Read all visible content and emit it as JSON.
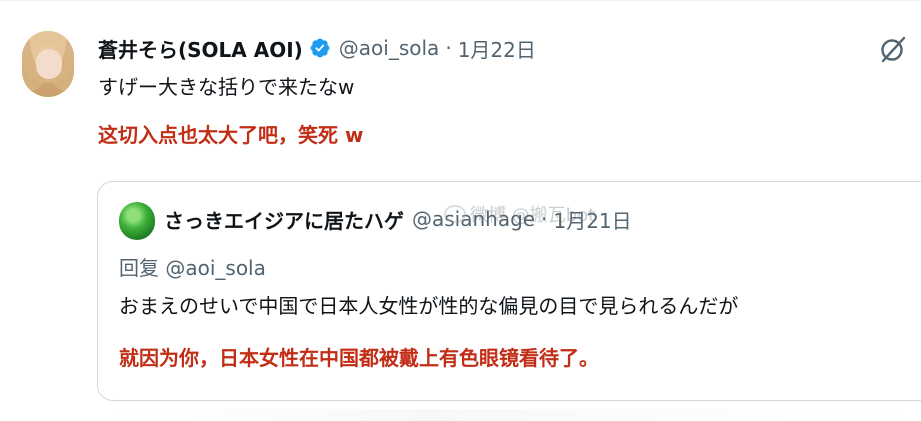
{
  "post": {
    "author": {
      "display_name": "蒼井そら(SOLA AOI)",
      "handle": "@aoi_sola",
      "verified": true,
      "avatar_icon": "user-avatar-photo"
    },
    "separator": "·",
    "date": "1月22日",
    "text": "すげー大きな括りで来たなw",
    "annotation": "这切入点也太大了吧，笑死 w",
    "grok_icon": "grok-slash-icon"
  },
  "quoted_post": {
    "author": {
      "display_name": "さっきエイジアに居たハゲ",
      "handle": "@asianhage",
      "avatar_icon": "green-blob-avatar"
    },
    "separator": "·",
    "date": "1月21日",
    "reply_to": "回复 @aoi_sola",
    "text": "おまえのせいで中国で日本人女性が性的な偏見の目で見られるんだが",
    "annotation": "就因为你，日本女性在中国都被戴上有色眼镜看待了。"
  },
  "watermark": {
    "text": "微博 @搬瓦bot"
  },
  "colors": {
    "annotation": "#c22d16",
    "secondary_text": "#536471",
    "verified_badge": "#1d9bf0",
    "border": "#cfd9de"
  }
}
